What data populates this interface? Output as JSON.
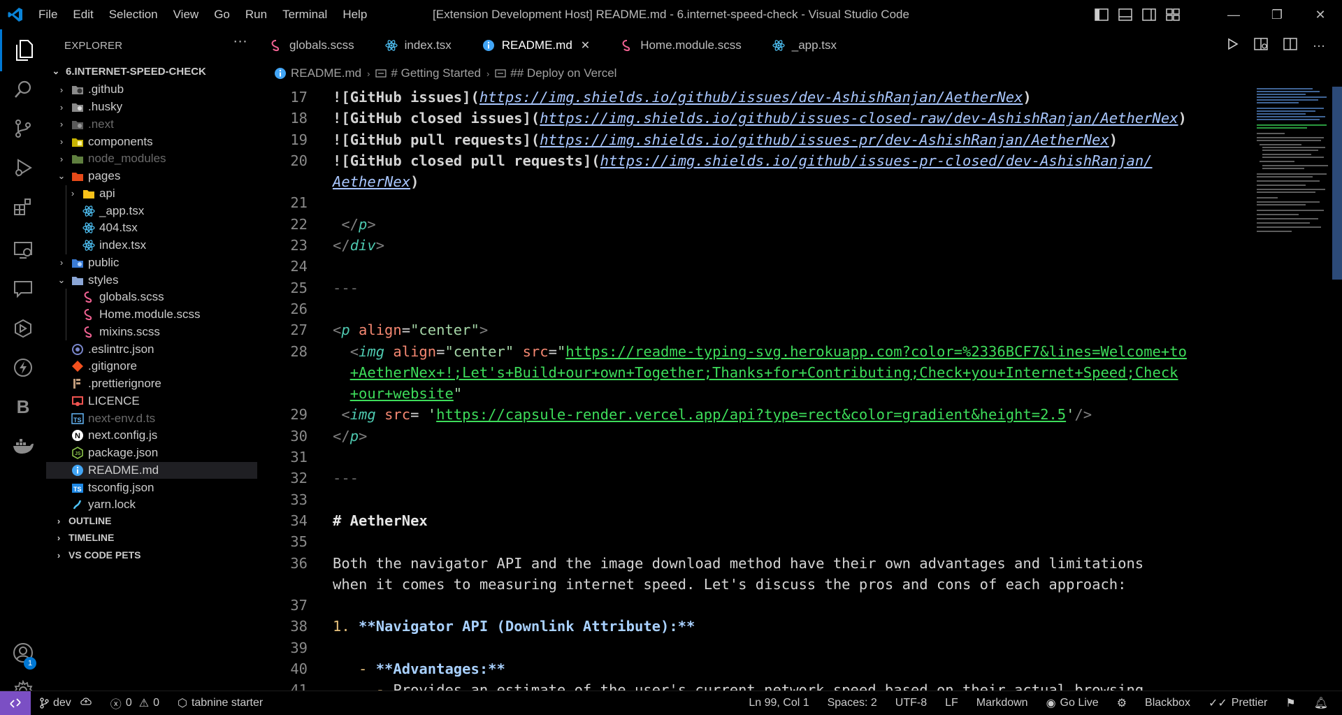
{
  "titlebar": {
    "menu": [
      "File",
      "Edit",
      "Selection",
      "View",
      "Go",
      "Run",
      "Terminal",
      "Help"
    ],
    "title": "[Extension Development Host] README.md - 6.internet-speed-check - Visual Studio Code"
  },
  "activity": {
    "items": [
      "explorer-icon",
      "search-icon",
      "source-control-icon",
      "run-debug-icon",
      "extensions-icon",
      "remote-explorer-icon",
      "comments-icon",
      "container-icon",
      "thunder-client-icon",
      "blackbox-icon",
      "docker-icon"
    ],
    "accounts_badge": "1"
  },
  "sidebar": {
    "title": "EXPLORER",
    "more": "···",
    "root": "6.INTERNET-SPEED-CHECK",
    "rows": [
      {
        "label": ".github",
        "icon": "folder-github-icon",
        "chev": "›",
        "dim": false,
        "level": 0
      },
      {
        "label": ".husky",
        "icon": "folder-husky-icon",
        "chev": "›",
        "dim": false,
        "level": 0
      },
      {
        "label": ".next",
        "icon": "folder-next-icon",
        "chev": "›",
        "dim": true,
        "level": 0
      },
      {
        "label": "components",
        "icon": "folder-components-icon",
        "chev": "›",
        "dim": false,
        "level": 0
      },
      {
        "label": "node_modules",
        "icon": "folder-node-icon",
        "chev": "›",
        "dim": true,
        "level": 0
      },
      {
        "label": "pages",
        "icon": "folder-pages-icon",
        "chev": "⌄",
        "dim": false,
        "level": 0
      },
      {
        "label": "api",
        "icon": "folder-api-icon",
        "chev": "›",
        "dim": false,
        "level": 1
      },
      {
        "label": "_app.tsx",
        "icon": "react-icon",
        "chev": "",
        "dim": false,
        "level": 1
      },
      {
        "label": "404.tsx",
        "icon": "react-icon",
        "chev": "",
        "dim": false,
        "level": 1
      },
      {
        "label": "index.tsx",
        "icon": "react-icon",
        "chev": "",
        "dim": false,
        "level": 1
      },
      {
        "label": "public",
        "icon": "folder-public-icon",
        "chev": "›",
        "dim": false,
        "level": 0
      },
      {
        "label": "styles",
        "icon": "folder-styles-icon",
        "chev": "⌄",
        "dim": false,
        "level": 0
      },
      {
        "label": "globals.scss",
        "icon": "sass-icon",
        "chev": "",
        "dim": false,
        "level": 1
      },
      {
        "label": "Home.module.scss",
        "icon": "sass-icon",
        "chev": "",
        "dim": false,
        "level": 1
      },
      {
        "label": "mixins.scss",
        "icon": "sass-icon",
        "chev": "",
        "dim": false,
        "level": 1
      },
      {
        "label": ".eslintrc.json",
        "icon": "eslint-icon",
        "chev": "",
        "dim": false,
        "level": 0
      },
      {
        "label": ".gitignore",
        "icon": "git-icon",
        "chev": "",
        "dim": false,
        "level": 0
      },
      {
        "label": ".prettierignore",
        "icon": "prettier-icon",
        "chev": "",
        "dim": false,
        "level": 0
      },
      {
        "label": "LICENCE",
        "icon": "license-icon",
        "chev": "",
        "dim": false,
        "level": 0
      },
      {
        "label": "next-env.d.ts",
        "icon": "typescript-def-icon",
        "chev": "",
        "dim": true,
        "level": 0
      },
      {
        "label": "next.config.js",
        "icon": "next-icon",
        "chev": "",
        "dim": false,
        "level": 0
      },
      {
        "label": "package.json",
        "icon": "nodejs-icon",
        "chev": "",
        "dim": false,
        "level": 0
      },
      {
        "label": "README.md",
        "icon": "info-icon",
        "chev": "",
        "dim": false,
        "level": 0,
        "selected": true
      },
      {
        "label": "tsconfig.json",
        "icon": "tsconfig-icon",
        "chev": "",
        "dim": false,
        "level": 0
      },
      {
        "label": "yarn.lock",
        "icon": "yarn-icon",
        "chev": "",
        "dim": false,
        "level": 0
      }
    ],
    "sections": [
      "OUTLINE",
      "TIMELINE",
      "VS CODE PETS"
    ]
  },
  "tabs": [
    {
      "label": "globals.scss",
      "icon": "sass-icon",
      "active": false
    },
    {
      "label": "index.tsx",
      "icon": "react-icon",
      "active": false
    },
    {
      "label": "README.md",
      "icon": "info-icon",
      "active": true,
      "close": "✕"
    },
    {
      "label": "Home.module.scss",
      "icon": "sass-icon",
      "active": false
    },
    {
      "label": "_app.tsx",
      "icon": "react-icon",
      "active": false
    }
  ],
  "breadcrumb": [
    "README.md",
    "# Getting Started",
    "## Deploy on Vercel"
  ],
  "code": [
    {
      "n": "17",
      "segs": [
        [
          "b",
          "!["
        ],
        [
          "b",
          "GitHub issues"
        ],
        [
          "b",
          "]("
        ],
        [
          "link",
          "https://img.shields.io/github/issues/dev-AshishRanjan/AetherNex"
        ],
        [
          "b",
          ")"
        ]
      ]
    },
    {
      "n": "18",
      "segs": [
        [
          "b",
          "!["
        ],
        [
          "b",
          "GitHub closed issues"
        ],
        [
          "b",
          "]("
        ],
        [
          "link",
          "https://img.shields.io/github/issues-closed-raw/dev-AshishRanjan/AetherNex"
        ],
        [
          "b",
          ")"
        ]
      ]
    },
    {
      "n": "19",
      "segs": [
        [
          "b",
          "!["
        ],
        [
          "b",
          "GitHub pull requests"
        ],
        [
          "b",
          "]("
        ],
        [
          "link",
          "https://img.shields.io/github/issues-pr/dev-AshishRanjan/AetherNex"
        ],
        [
          "b",
          ")"
        ]
      ]
    },
    {
      "n": "20",
      "segs": [
        [
          "b",
          "!["
        ],
        [
          "b",
          "GitHub closed pull requests"
        ],
        [
          "b",
          "]("
        ],
        [
          "link",
          "https://img.shields.io/github/issues-pr-closed/dev-AshishRanjan/"
        ]
      ]
    },
    {
      "n": "",
      "segs": [
        [
          "link",
          "AetherNex"
        ],
        [
          "b",
          ")"
        ]
      ]
    },
    {
      "n": "21",
      "segs": []
    },
    {
      "n": "22",
      "segs": [
        [
          "w",
          " "
        ],
        [
          "tagp",
          "</"
        ],
        [
          "tag",
          "p"
        ],
        [
          "tagp",
          ">"
        ]
      ]
    },
    {
      "n": "23",
      "segs": [
        [
          "tagp",
          "</"
        ],
        [
          "tag",
          "div"
        ],
        [
          "tagp",
          ">"
        ]
      ]
    },
    {
      "n": "24",
      "segs": []
    },
    {
      "n": "25",
      "segs": [
        [
          "hr",
          "---"
        ]
      ]
    },
    {
      "n": "26",
      "segs": []
    },
    {
      "n": "27",
      "segs": [
        [
          "tagp",
          "<"
        ],
        [
          "tag",
          "p"
        ],
        [
          "w",
          " "
        ],
        [
          "attr",
          "align"
        ],
        [
          "w",
          "="
        ],
        [
          "str",
          "\"center\""
        ],
        [
          "tagp",
          ">"
        ]
      ]
    },
    {
      "n": "28",
      "segs": [
        [
          "w",
          "  "
        ],
        [
          "tagp",
          "<"
        ],
        [
          "tag",
          "img"
        ],
        [
          "w",
          " "
        ],
        [
          "attr",
          "align"
        ],
        [
          "w",
          "="
        ],
        [
          "str",
          "\"center\""
        ],
        [
          "w",
          " "
        ],
        [
          "attr",
          "src"
        ],
        [
          "w",
          "="
        ],
        [
          "str",
          "\""
        ],
        [
          "url",
          "https://readme-typing-svg.herokuapp.com?color=%2336BCF7&lines=Welcome+to"
        ]
      ]
    },
    {
      "n": "",
      "segs": [
        [
          "w",
          "  "
        ],
        [
          "url",
          "+AetherNex+!;Let's+Build+our+own+Together;Thanks+for+Contributing;Check+you+Internet+Speed;Check"
        ]
      ]
    },
    {
      "n": "",
      "segs": [
        [
          "w",
          "  "
        ],
        [
          "url",
          "+our+website"
        ],
        [
          "str",
          "\""
        ]
      ]
    },
    {
      "n": "29",
      "segs": [
        [
          "w",
          " "
        ],
        [
          "tagp",
          "<"
        ],
        [
          "tag",
          "img"
        ],
        [
          "w",
          " "
        ],
        [
          "attr",
          "src"
        ],
        [
          "w",
          "= "
        ],
        [
          "str",
          "'"
        ],
        [
          "url",
          "https://capsule-render.vercel.app/api?type=rect&color=gradient&height=2.5"
        ],
        [
          "str",
          "'"
        ],
        [
          "tagp",
          "/>"
        ]
      ]
    },
    {
      "n": "30",
      "segs": [
        [
          "tagp",
          "</"
        ],
        [
          "tag",
          "p"
        ],
        [
          "tagp",
          ">"
        ]
      ]
    },
    {
      "n": "31",
      "segs": []
    },
    {
      "n": "32",
      "segs": [
        [
          "hr",
          "---"
        ]
      ]
    },
    {
      "n": "33",
      "segs": []
    },
    {
      "n": "34",
      "segs": [
        [
          "head",
          "# AetherNex"
        ]
      ]
    },
    {
      "n": "35",
      "segs": []
    },
    {
      "n": "36",
      "segs": [
        [
          "w",
          "Both the navigator API and the image download method have their own advantages and limitations"
        ]
      ]
    },
    {
      "n": "",
      "segs": [
        [
          "w",
          "when it comes to measuring internet speed. Let's discuss the pros and cons of each approach:"
        ]
      ]
    },
    {
      "n": "37",
      "segs": []
    },
    {
      "n": "38",
      "segs": [
        [
          "listnum",
          "1. "
        ],
        [
          "bold",
          "**Navigator API (Downlink Attribute):**"
        ]
      ]
    },
    {
      "n": "39",
      "segs": []
    },
    {
      "n": "40",
      "segs": [
        [
          "w",
          "   "
        ],
        [
          "listnum",
          "- "
        ],
        [
          "bold",
          "**Advantages:**"
        ]
      ]
    },
    {
      "n": "41",
      "segs": [
        [
          "w",
          "     "
        ],
        [
          "listnum",
          "- "
        ],
        [
          "w",
          "Provides an estimate of the user's current network speed based on their actual browsing"
        ]
      ]
    }
  ],
  "status": {
    "branch": "dev",
    "errors": "0",
    "warnings": "0",
    "tabnine": "tabnine starter",
    "position": "Ln 99, Col 1",
    "spaces": "Spaces: 2",
    "encoding": "UTF-8",
    "eol": "LF",
    "language": "Markdown",
    "golive": "Go Live",
    "blackbox": "Blackbox",
    "prettier": "Prettier"
  }
}
